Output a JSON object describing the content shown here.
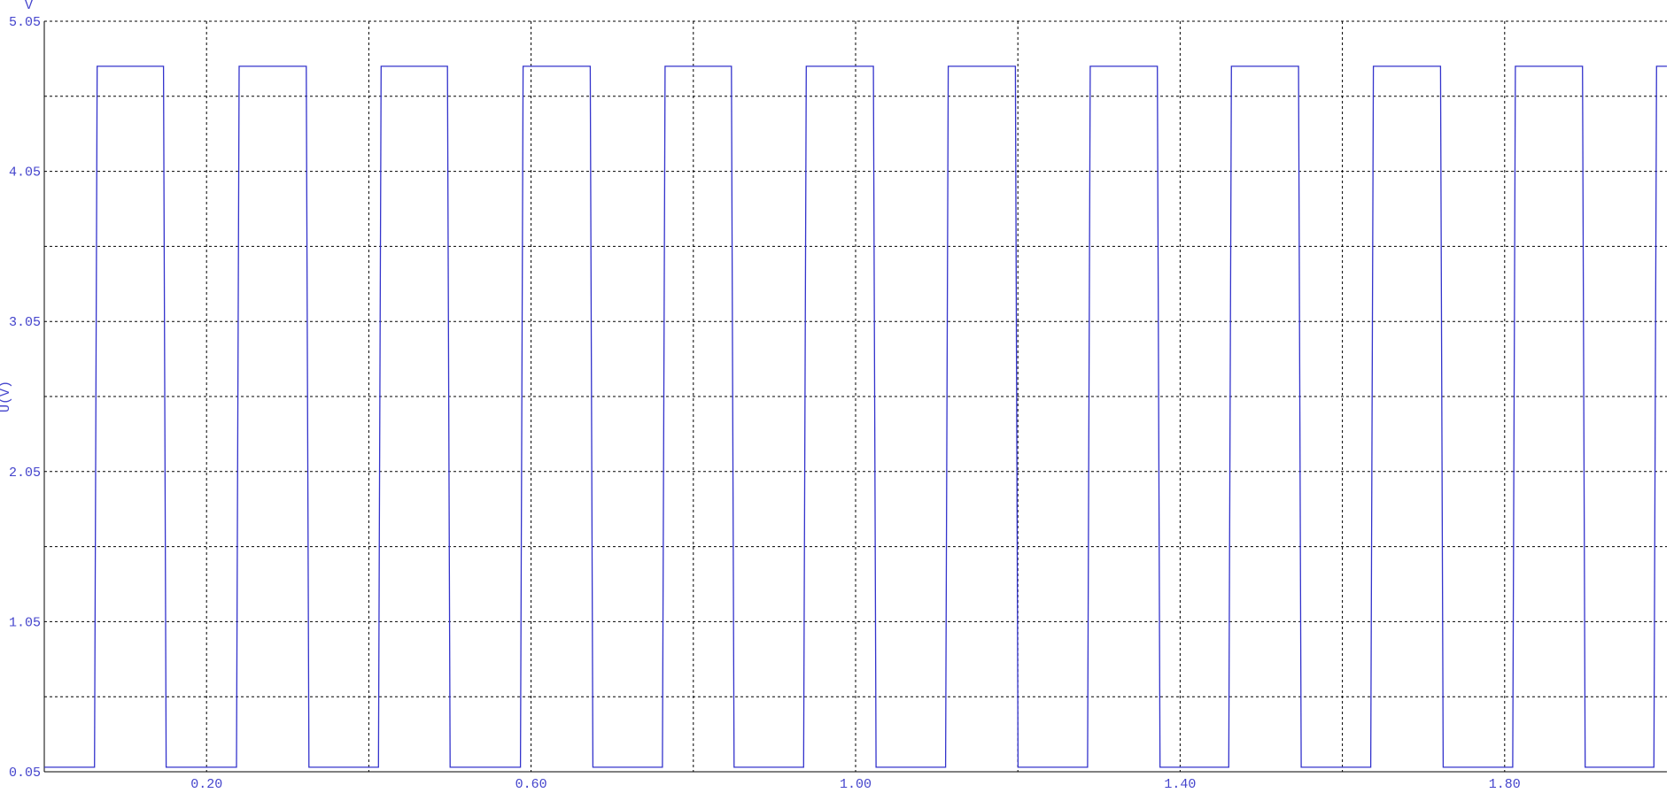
{
  "chart_data": {
    "type": "line",
    "title": "",
    "xlabel": "",
    "ylabel": "V",
    "ylabel_side": "U(V)",
    "xlim": [
      0.0,
      2.0
    ],
    "ylim": [
      0.05,
      5.05
    ],
    "x_ticks": [
      {
        "value": 0.2,
        "label": "0.20"
      },
      {
        "value": 0.6,
        "label": "0.60"
      },
      {
        "value": 1.0,
        "label": "1.00"
      },
      {
        "value": 1.4,
        "label": "1.40"
      },
      {
        "value": 1.8,
        "label": "1.80"
      }
    ],
    "x_grid": [
      0.2,
      0.4,
      0.6,
      0.8,
      1.0,
      1.2,
      1.4,
      1.6,
      1.8
    ],
    "y_ticks": [
      {
        "value": 0.05,
        "label": "0.05"
      },
      {
        "value": 1.05,
        "label": "1.05"
      },
      {
        "value": 2.05,
        "label": "2.05"
      },
      {
        "value": 3.05,
        "label": "3.05"
      },
      {
        "value": 4.05,
        "label": "4.05"
      },
      {
        "value": 5.05,
        "label": "5.05"
      }
    ],
    "y_grid": [
      0.55,
      1.05,
      1.55,
      2.05,
      2.55,
      3.05,
      3.55,
      4.05,
      4.55,
      5.05
    ],
    "grid": true,
    "colors": {
      "signal": "#3333cc",
      "text": "#4444cc",
      "axis": "#000000",
      "grid": "#000000"
    },
    "series": [
      {
        "name": "",
        "low": 0.08,
        "high": 4.75,
        "pulses": [
          [
            0.063,
            0.148
          ],
          [
            0.238,
            0.324
          ],
          [
            0.413,
            0.498
          ],
          [
            0.588,
            0.674
          ],
          [
            0.763,
            0.848
          ],
          [
            0.937,
            1.023
          ],
          [
            1.112,
            1.198
          ],
          [
            1.287,
            1.373
          ],
          [
            1.461,
            1.547
          ],
          [
            1.636,
            1.722
          ],
          [
            1.811,
            1.897
          ],
          [
            1.985,
            2.0
          ]
        ]
      }
    ]
  }
}
